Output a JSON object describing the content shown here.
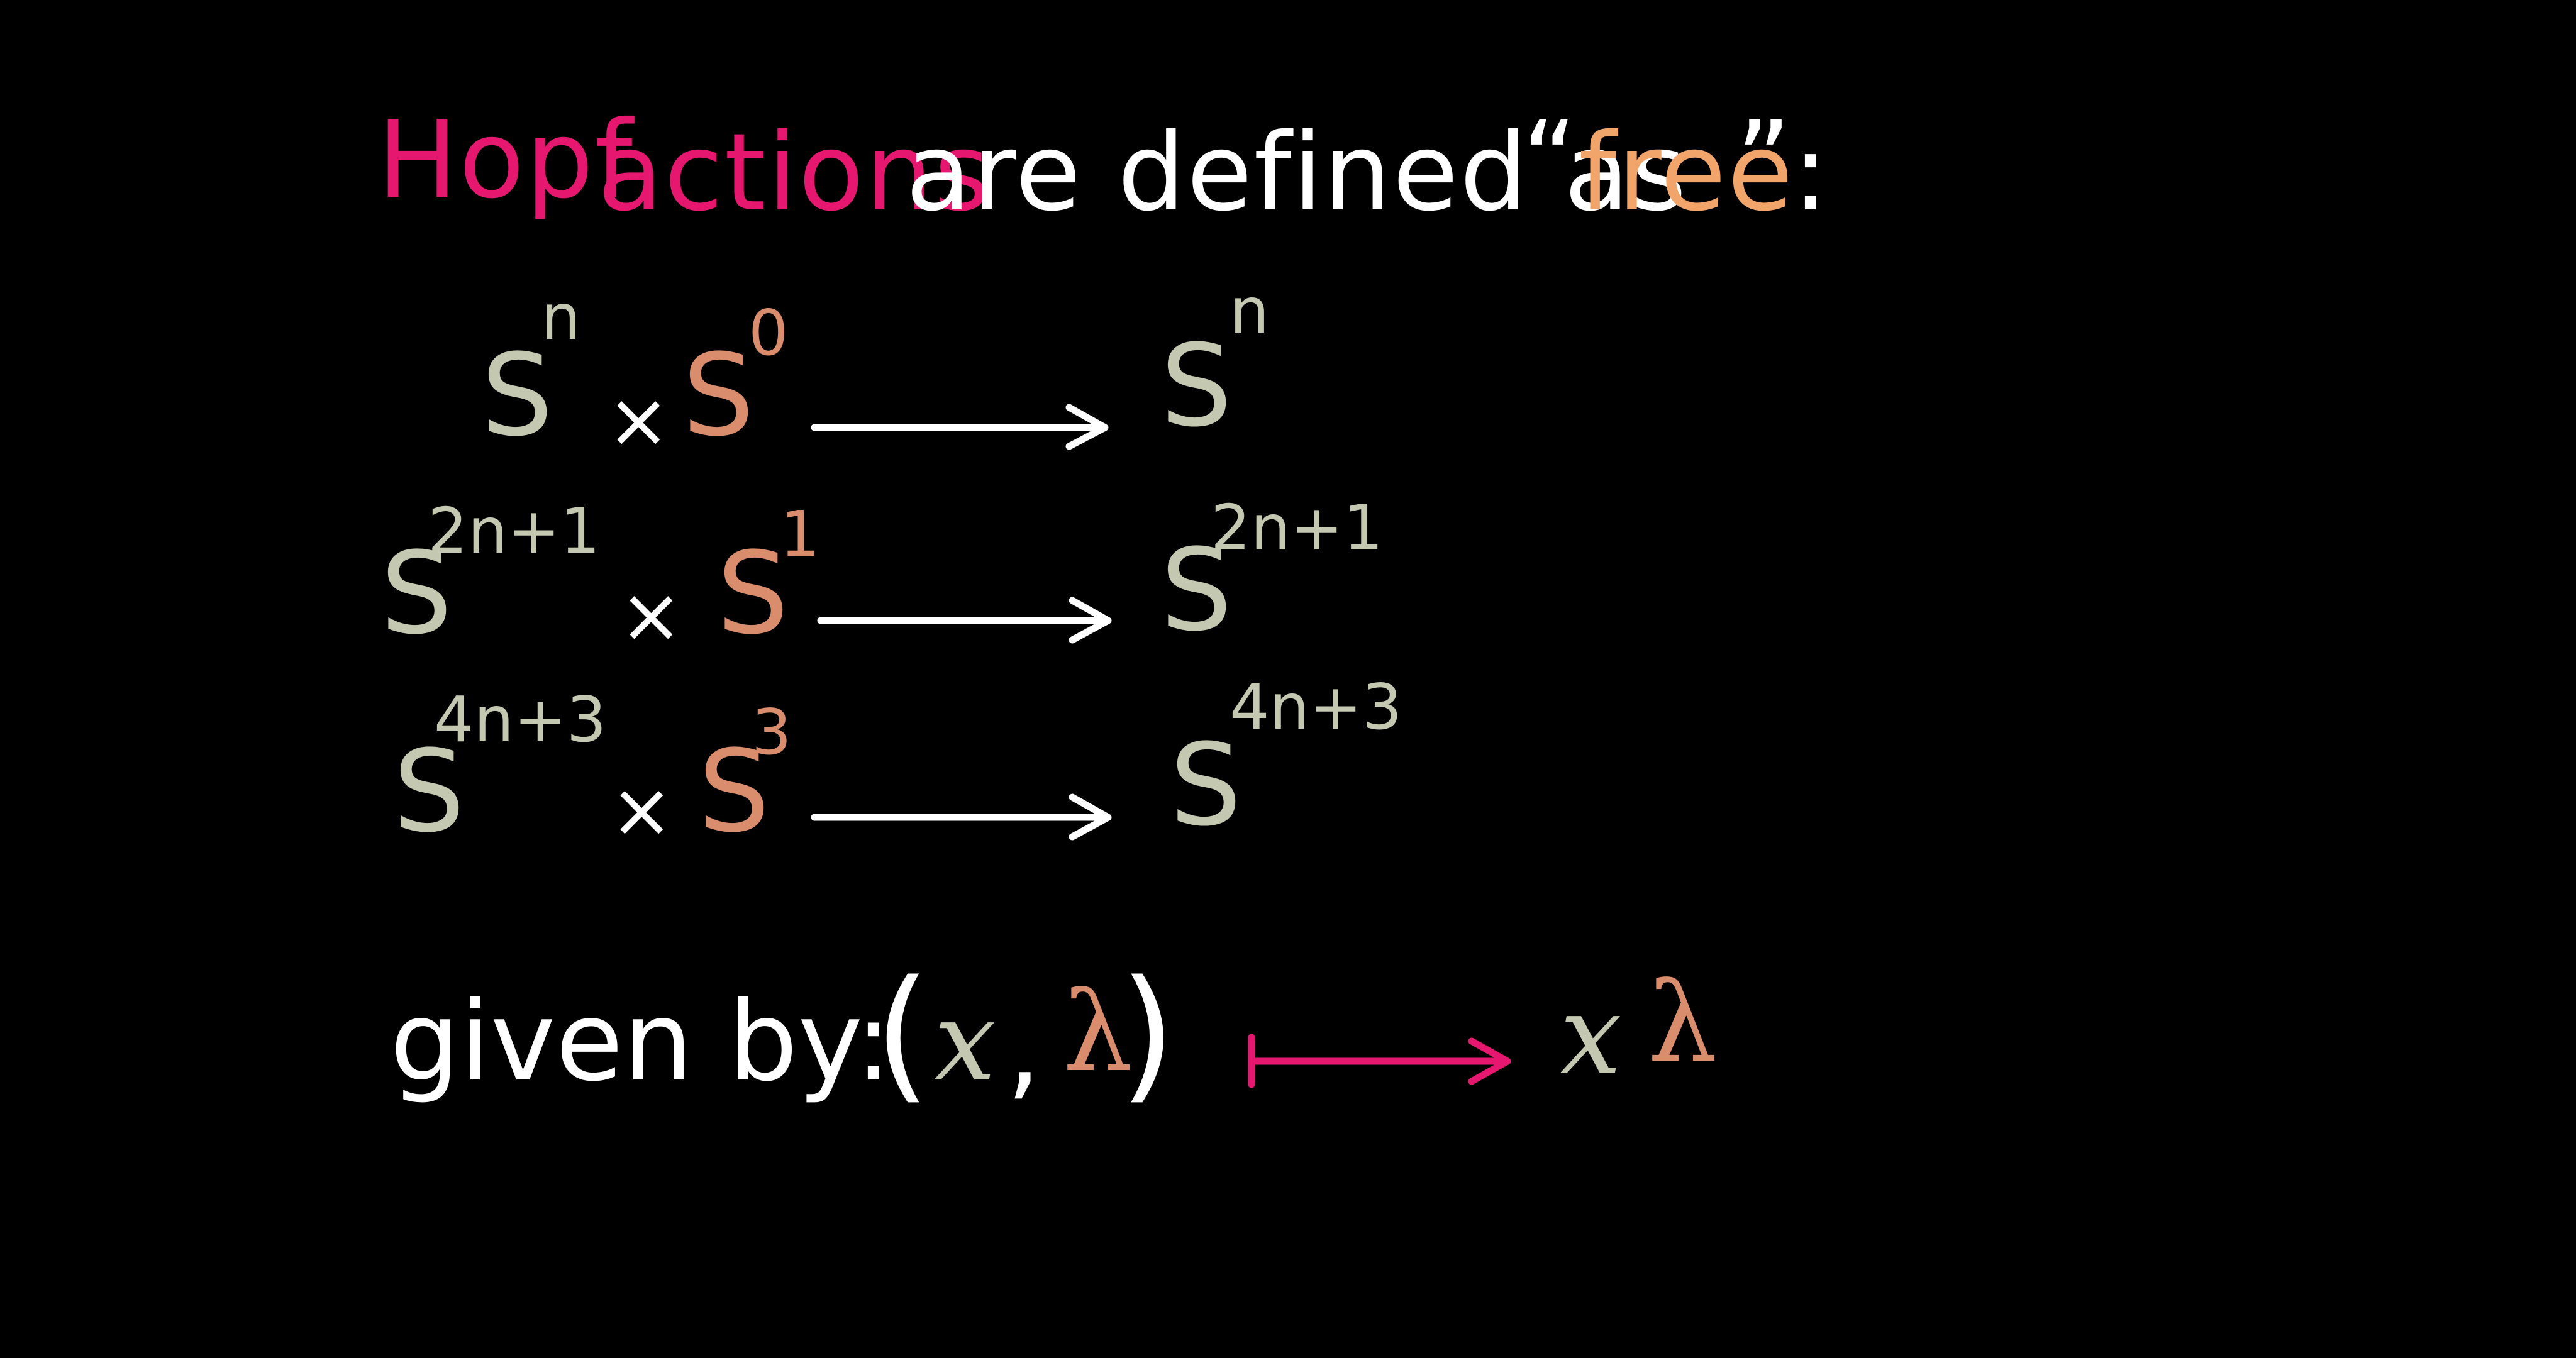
{
  "title": {
    "hopf": "Hopf",
    "actions": "actions",
    "middle": "are defined as",
    "open_quote": "“",
    "free": "free",
    "close_quote": "”",
    "colon": ":"
  },
  "rows": [
    {
      "domain_base": "S",
      "domain_exp": "n",
      "times": "×",
      "group_base": "S",
      "group_exp": "0",
      "target_base": "S",
      "target_exp": "n"
    },
    {
      "domain_base": "S",
      "domain_exp": "2n+1",
      "times": "×",
      "group_base": "S",
      "group_exp": "1",
      "target_base": "S",
      "target_exp": "2n+1"
    },
    {
      "domain_base": "S",
      "domain_exp": "4n+3",
      "times": "×",
      "group_base": "S",
      "group_exp": "3",
      "target_base": "S",
      "target_exp": "4n+3"
    }
  ],
  "given": {
    "label": "given by:",
    "open_paren": "(",
    "x": "x",
    "comma": ",",
    "lambda": "λ",
    "close_paren": ")",
    "result_x": "x",
    "result_lambda": "λ"
  },
  "colors": {
    "background": "#000000",
    "pink": "#e5176f",
    "white": "#ffffff",
    "peach": "#f2a56a",
    "sage": "#c5c8b0",
    "clay": "#d98d6c"
  }
}
